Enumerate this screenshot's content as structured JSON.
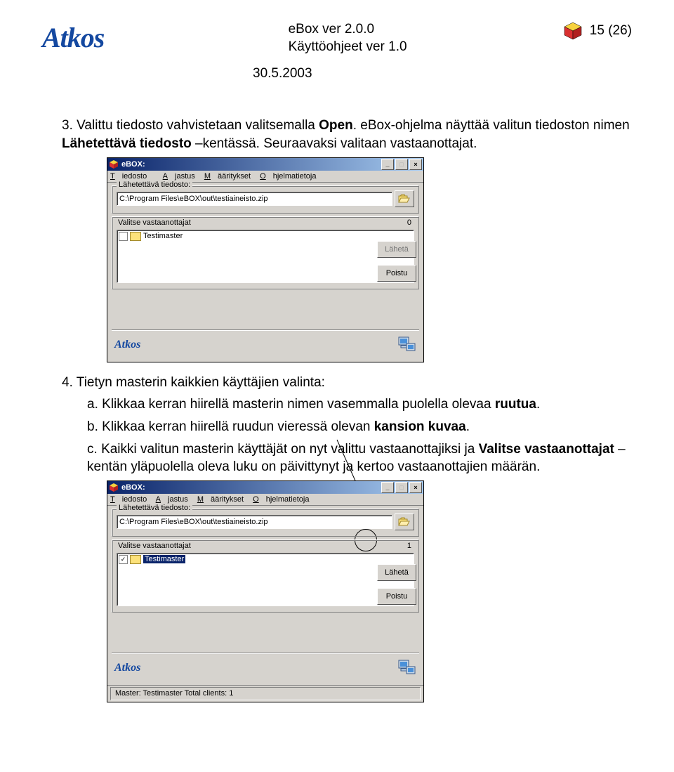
{
  "header": {
    "logo": "Atkos",
    "line1": "eBox ver 2.0.0",
    "line2": "Käyttöohjeet ver 1.0",
    "page_num": "15 (26)",
    "date": "30.5.2003"
  },
  "section3": {
    "num": "3.",
    "text_a": "Valittu tiedosto vahvistetaan valitsemalla ",
    "bold_open": "Open",
    "text_b": ". eBox-ohjelma näyttää valitun tiedoston nimen ",
    "bold_field": "Lähetettävä tiedosto",
    "text_c": " –kentässä. Seuraavaksi valitaan vastaanottajat."
  },
  "win1": {
    "title": "eBOX:",
    "menu": {
      "m1": "Tiedosto",
      "m2": "Ajastus",
      "m3": "Määritykset",
      "m4": "Ohjelmatietoja"
    },
    "group_file": "Lähetettävä tiedosto:",
    "file_value": "C:\\Program Files\\eBOX\\out\\testiaineisto.zip",
    "recv_label": "Valitse vastaanottajat",
    "recv_count": "0",
    "item": "Testimaster",
    "btn_send": "Lähetä",
    "btn_exit": "Poistu",
    "brand": "Atkos"
  },
  "section4": {
    "num": "4.",
    "title": "Tietyn masterin kaikkien käyttäjien valinta:",
    "a_label": "a.",
    "a_text1": "Klikkaa kerran hiirellä masterin nimen vasemmalla puolella olevaa ",
    "a_bold": "ruutua",
    "a_text2": ".",
    "b_label": "b.",
    "b_text1": "Klikkaa kerran hiirellä ruudun vieressä olevan ",
    "b_bold": "kansion kuvaa",
    "b_text2": ".",
    "c_label": "c.",
    "c_text1": "Kaikki valitun masterin käyttäjät on nyt valittu vastaanottajiksi ja ",
    "c_bold1": "Valitse vastaanottajat",
    "c_text2": " –kentän yläpuolella oleva luku on päivittynyt ja kertoo vastaanottajien määrän."
  },
  "win2": {
    "title": "eBOX:",
    "menu": {
      "m1": "Tiedosto",
      "m2": "Ajastus",
      "m3": "Määritykset",
      "m4": "Ohjelmatietoja"
    },
    "group_file": "Lähetettävä tiedosto:",
    "file_value": "C:\\Program Files\\eBOX\\out\\testiaineisto.zip",
    "recv_label": "Valitse vastaanottajat",
    "recv_count": "1",
    "item": "Testimaster",
    "btn_send": "Lähetä",
    "btn_exit": "Poistu",
    "brand": "Atkos",
    "status": "Master: Testimaster  Total clients: 1"
  }
}
